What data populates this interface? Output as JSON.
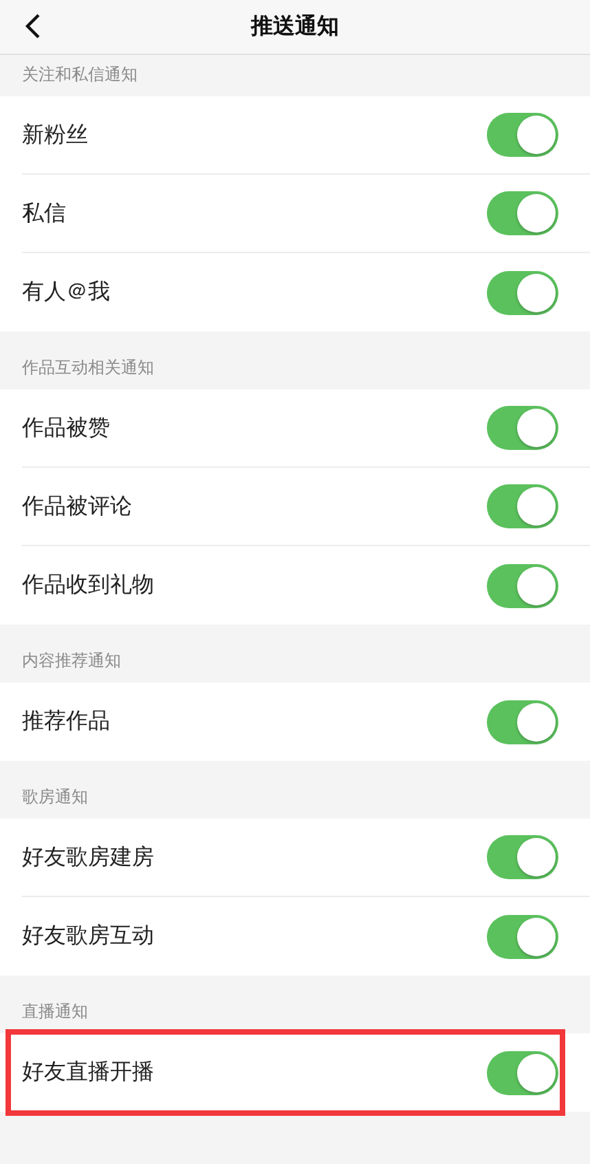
{
  "header": {
    "title": "推送通知"
  },
  "sections": [
    {
      "title": "关注和私信通知",
      "items": [
        {
          "label": "新粉丝",
          "on": true
        },
        {
          "label": "私信",
          "on": true
        },
        {
          "label": "有人＠我",
          "on": true
        }
      ]
    },
    {
      "title": "作品互动相关通知",
      "items": [
        {
          "label": "作品被赞",
          "on": true
        },
        {
          "label": "作品被评论",
          "on": true
        },
        {
          "label": "作品收到礼物",
          "on": true
        }
      ]
    },
    {
      "title": "内容推荐通知",
      "items": [
        {
          "label": "推荐作品",
          "on": true
        }
      ]
    },
    {
      "title": "歌房通知",
      "items": [
        {
          "label": "好友歌房建房",
          "on": true
        },
        {
          "label": "好友歌房互动",
          "on": true
        }
      ]
    },
    {
      "title": "直播通知",
      "items": [
        {
          "label": "好友直播开播",
          "on": true,
          "highlighted": true
        }
      ]
    }
  ]
}
